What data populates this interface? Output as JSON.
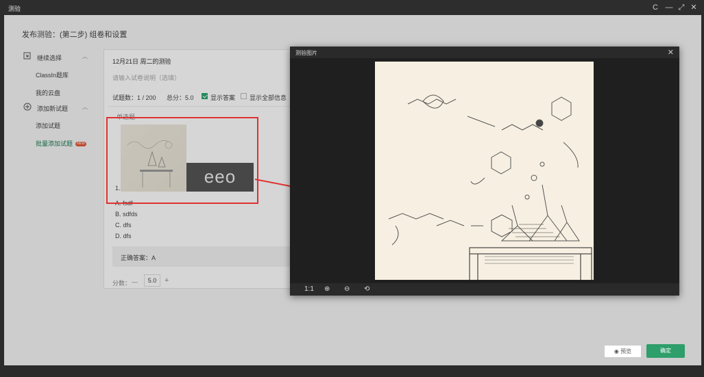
{
  "window": {
    "title": "测验",
    "controls": {
      "refresh": "C",
      "minimize": "—",
      "maximize": "⤢",
      "close": "✕"
    }
  },
  "page": {
    "title": "发布测验：(第二步) 组卷和设置"
  },
  "sidebar": {
    "group1": {
      "label": "继续选择",
      "icon": "import-icon"
    },
    "group1_items": [
      "ClassIn题库",
      "我的云盘"
    ],
    "group2": {
      "label": "添加新试题",
      "icon": "plus-circle-icon"
    },
    "group2_items": [
      "添加试题",
      "批量添加试题"
    ],
    "new_badge": "NEW"
  },
  "exam": {
    "name": "12月21日 周二的测验",
    "desc_placeholder": "请输入试卷说明（选填）",
    "count": "试题数：1 / 200",
    "total": "总分：5.0",
    "show_answer": "显示答案",
    "show_all": "显示全部信息"
  },
  "question": {
    "type": "单选题",
    "number": "1.",
    "watermark": "eeo",
    "options": [
      "A. fsdf",
      "B. sdfds",
      "C. dfs",
      "D. dfs"
    ],
    "answer": "正确答案：A",
    "score_label": "分数：",
    "score_minus": "—",
    "score_value": "5.0",
    "score_plus": "+"
  },
  "viewer": {
    "title": "测验图片",
    "close": "✕",
    "tools": {
      "actual_size": "1:1",
      "zoom_in": "⊕",
      "zoom_out": "⊖",
      "rotate": "⟲"
    }
  },
  "footer": {
    "preview": "预览",
    "confirm": "确定"
  },
  "colors": {
    "accent": "#2e9e6a",
    "highlight": "#e03030",
    "badge": "#e05a3a"
  }
}
